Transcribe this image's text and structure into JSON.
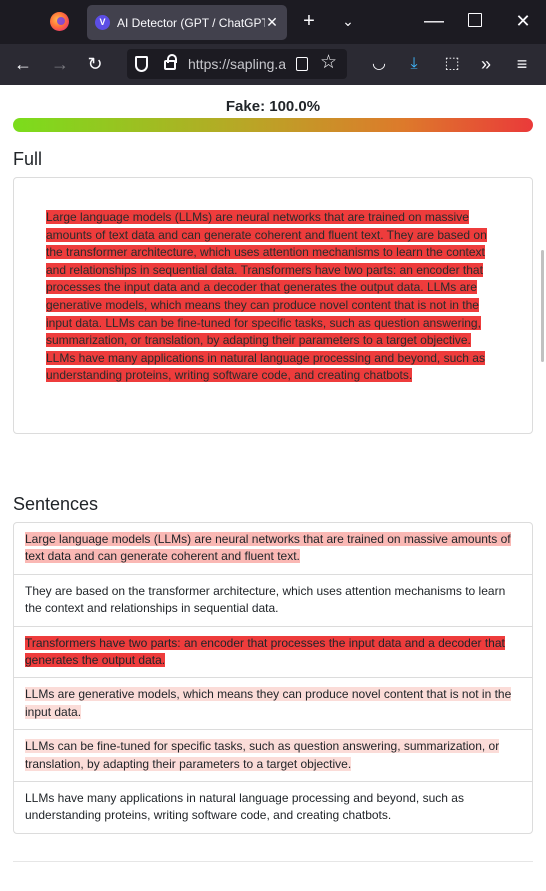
{
  "browser": {
    "tab_title": "AI Detector (GPT / ChatGPT",
    "tab_close": "✕",
    "new_tab": "+",
    "list_tabs": "⌄",
    "minimize": "—",
    "close": "✕",
    "url": "https://sapling.a",
    "back": "←",
    "forward": "→",
    "reload": "↻",
    "star": "☆",
    "pocket": "◡",
    "download": "⤓",
    "extensions": "⬚",
    "overflow": "»",
    "menu": "≡"
  },
  "result": {
    "fake_label": "Fake: 100.0%",
    "fake_score": 1.0
  },
  "full": {
    "title": "Full",
    "text": "Large language models (LLMs) are neural networks that are trained on massive amounts of text data and can generate coherent and fluent text. They are based on the transformer architecture, which uses attention mechanisms to learn the context and relationships in sequential data. Transformers have two parts: an encoder that processes the input data and a decoder that generates the output data. LLMs are generative models, which means they can produce novel content that is not in the input data. LLMs can be fine-tuned for specific tasks, such as question answering, summarization, or translation, by adapting their parameters to a target objective. LLMs have many applications in natural language processing and beyond, such as understanding proteins, writing software code, and creating chatbots."
  },
  "sentences": {
    "title": "Sentences",
    "items": [
      {
        "text": "Large language models (LLMs) are neural networks that are trained on massive amounts of text data and can generate coherent and fluent text.",
        "level": "light"
      },
      {
        "text": "They are based on the transformer architecture, which uses attention mechanisms to learn the context and relationships in sequential data.",
        "level": "none"
      },
      {
        "text": "Transformers have two parts: an encoder that processes the input data and a decoder that generates the output data.",
        "level": "strong"
      },
      {
        "text": "LLMs are generative models, which means they can produce novel content that is not in the input data.",
        "level": "faint"
      },
      {
        "text": "LLMs can be fine-tuned for specific tasks, such as question answering, summarization, or translation, by adapting their parameters to a target objective.",
        "level": "faint"
      },
      {
        "text": "LLMs have many applications in natural language processing and beyond, such as understanding proteins, writing software code, and creating chatbots.",
        "level": "none"
      }
    ]
  },
  "colors": {
    "strong": "#ee3c3c",
    "light": "#fab8b4",
    "faint": "#fbdcd8"
  }
}
